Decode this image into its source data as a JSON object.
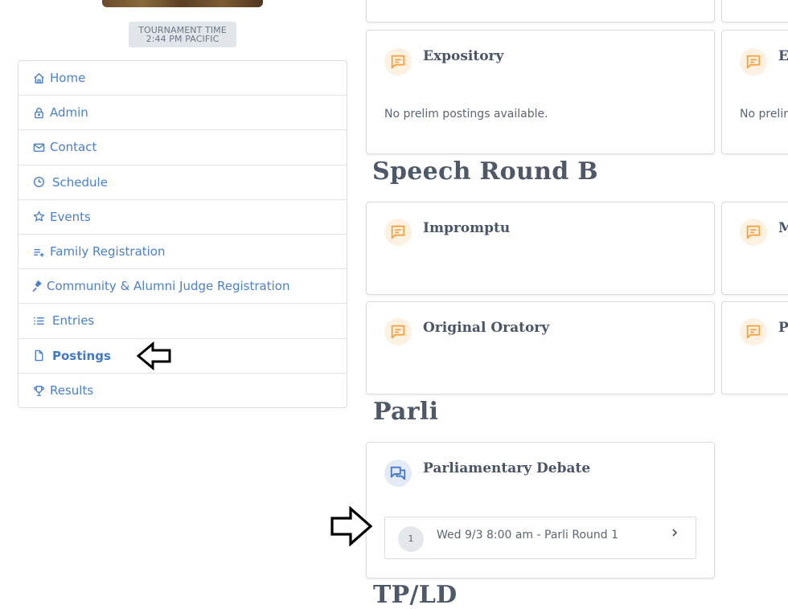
{
  "tournament_time": {
    "line1": "TOURNAMENT TIME",
    "line2": "2:44 PM PACIFIC"
  },
  "nav": {
    "items": [
      {
        "label": "Home",
        "icon": "home-icon"
      },
      {
        "label": "Admin",
        "icon": "lock-icon"
      },
      {
        "label": "Contact",
        "icon": "mail-icon"
      },
      {
        "label": "Schedule",
        "icon": "clock-icon"
      },
      {
        "label": "Events",
        "icon": "star-icon"
      },
      {
        "label": "Family Registration",
        "icon": "playlist-add-icon"
      },
      {
        "label": "Community & Alumni Judge Registration",
        "icon": "gavel-icon"
      },
      {
        "label": "Entries",
        "icon": "list-icon"
      },
      {
        "label": "Postings",
        "icon": "file-icon",
        "active": true
      },
      {
        "label": "Results",
        "icon": "trophy-icon"
      }
    ]
  },
  "cards": {
    "expository": {
      "title": "Expository",
      "body": "No prelim postings available."
    },
    "right_partial_1": {
      "title": "E",
      "body": "No prelim"
    },
    "impromptu": {
      "title": "Impromptu"
    },
    "right_partial_2": {
      "title": "M"
    },
    "original_oratory": {
      "title": "Original Oratory"
    },
    "right_partial_3": {
      "title": "P"
    },
    "parliamentary_debate": {
      "title": "Parliamentary Debate",
      "rounds": [
        {
          "number": "1",
          "label": "Wed 9/3 8:00 am - Parli Round 1"
        }
      ]
    }
  },
  "sections": {
    "speech_round_b": "Speech Round B",
    "parli": "Parli",
    "tpld": "TP/LD"
  },
  "colors": {
    "link": "#4a80d0",
    "speech_icon": "#f4a340",
    "debate_icon": "#3f78cf",
    "heading": "#4d5868"
  }
}
